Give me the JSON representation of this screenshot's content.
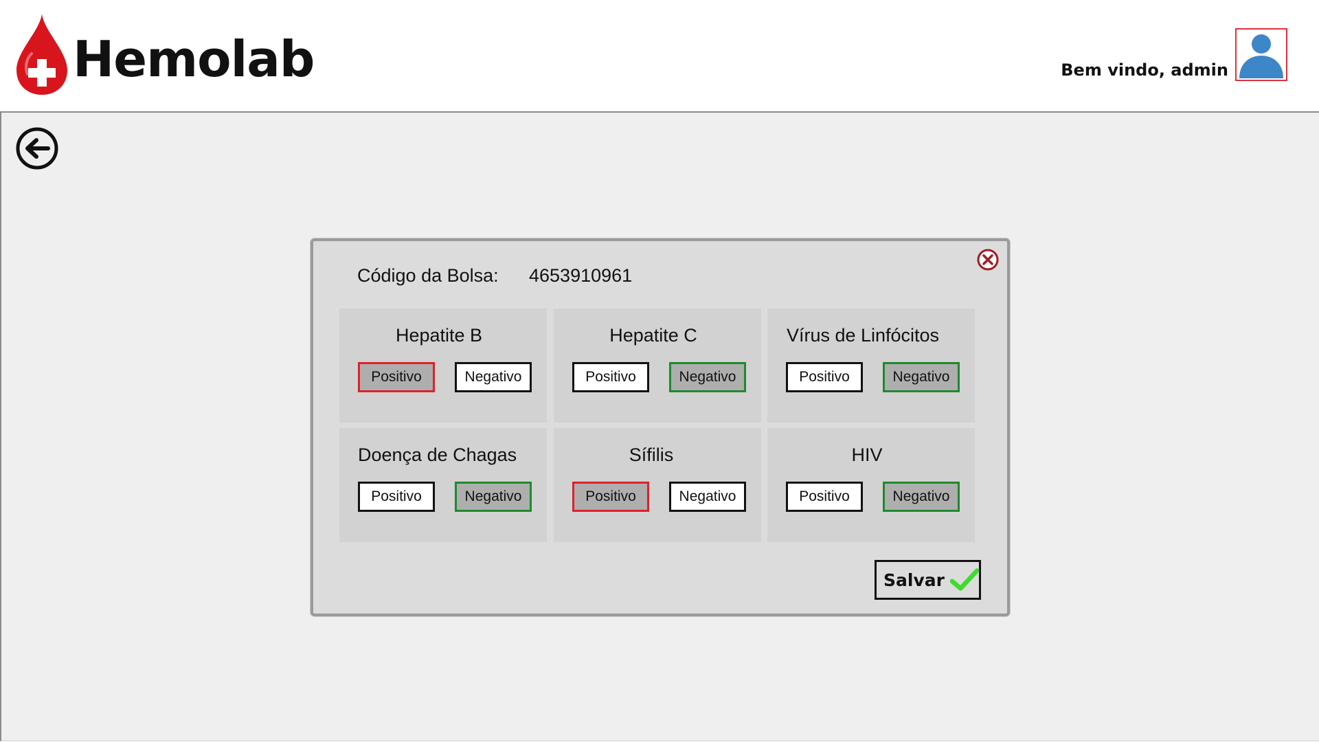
{
  "app": {
    "name": "Hemolab"
  },
  "header": {
    "welcome": "Bem vindo, admin"
  },
  "icons": {
    "logo": "blood-drop-cross-icon",
    "avatar": "user-avatar-icon",
    "back": "back-arrow-icon",
    "close": "close-circle-icon",
    "save": "checkmark-icon"
  },
  "colors": {
    "brand_red": "#d8151d",
    "positive_selected": "#e0202a",
    "negative_selected": "#1f8a2c",
    "avatar_blue": "#3d86c8",
    "check_green": "#3fdc2f"
  },
  "dialog": {
    "code_label": "Código da Bolsa:",
    "code_value": "4653910961",
    "tests": [
      {
        "name": "Hepatite B",
        "positive_label": "Positivo",
        "negative_label": "Negativo",
        "selected": "positive"
      },
      {
        "name": "Hepatite C",
        "positive_label": "Positivo",
        "negative_label": "Negativo",
        "selected": "negative"
      },
      {
        "name": "Vírus de Linfócitos",
        "positive_label": "Positivo",
        "negative_label": "Negativo",
        "selected": "negative"
      },
      {
        "name": "Doença de Chagas",
        "positive_label": "Positivo",
        "negative_label": "Negativo",
        "selected": "negative"
      },
      {
        "name": "Sífilis",
        "positive_label": "Positivo",
        "negative_label": "Negativo",
        "selected": "positive"
      },
      {
        "name": "HIV",
        "positive_label": "Positivo",
        "negative_label": "Negativo",
        "selected": "negative"
      }
    ],
    "save_label": "Salvar"
  }
}
